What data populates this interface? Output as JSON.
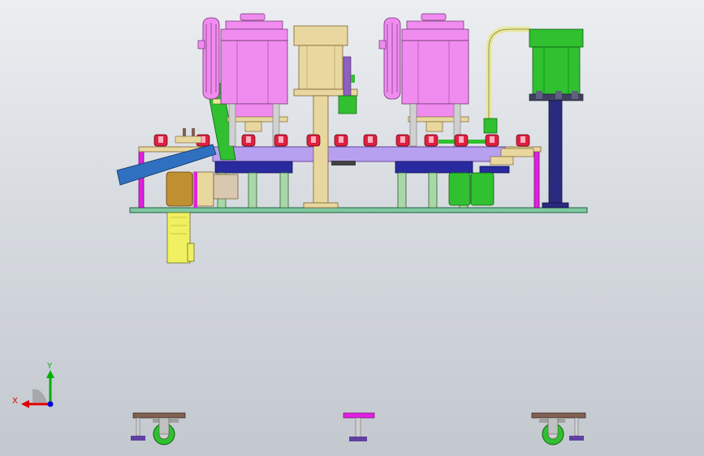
{
  "viewport": {
    "background_top": "#eceef1",
    "background_bottom": "#c3c8cf"
  },
  "model": {
    "colors": {
      "pink": "#f08cf0",
      "pink_dark": "#c060c0",
      "magenta": "#e020e0",
      "purple_plate": "#b8a0f0",
      "navy": "#2a2aa0",
      "green": "#30c030",
      "green_dark": "#108010",
      "green_light": "#a8d8a8",
      "tan": "#e8d8a0",
      "tan_dark": "#b8a060",
      "gold": "#c09030",
      "yellow": "#f0f060",
      "red": "#e02040",
      "blue_chute": "#3070c0",
      "teal_base": "#80c8a0",
      "brown": "#806050",
      "silver": "#d0d0d0"
    }
  },
  "triad": {
    "x_label": "X",
    "y_label": "Y",
    "x_color": "#e00000",
    "y_color": "#00b000",
    "z_color": "#0000e0"
  }
}
